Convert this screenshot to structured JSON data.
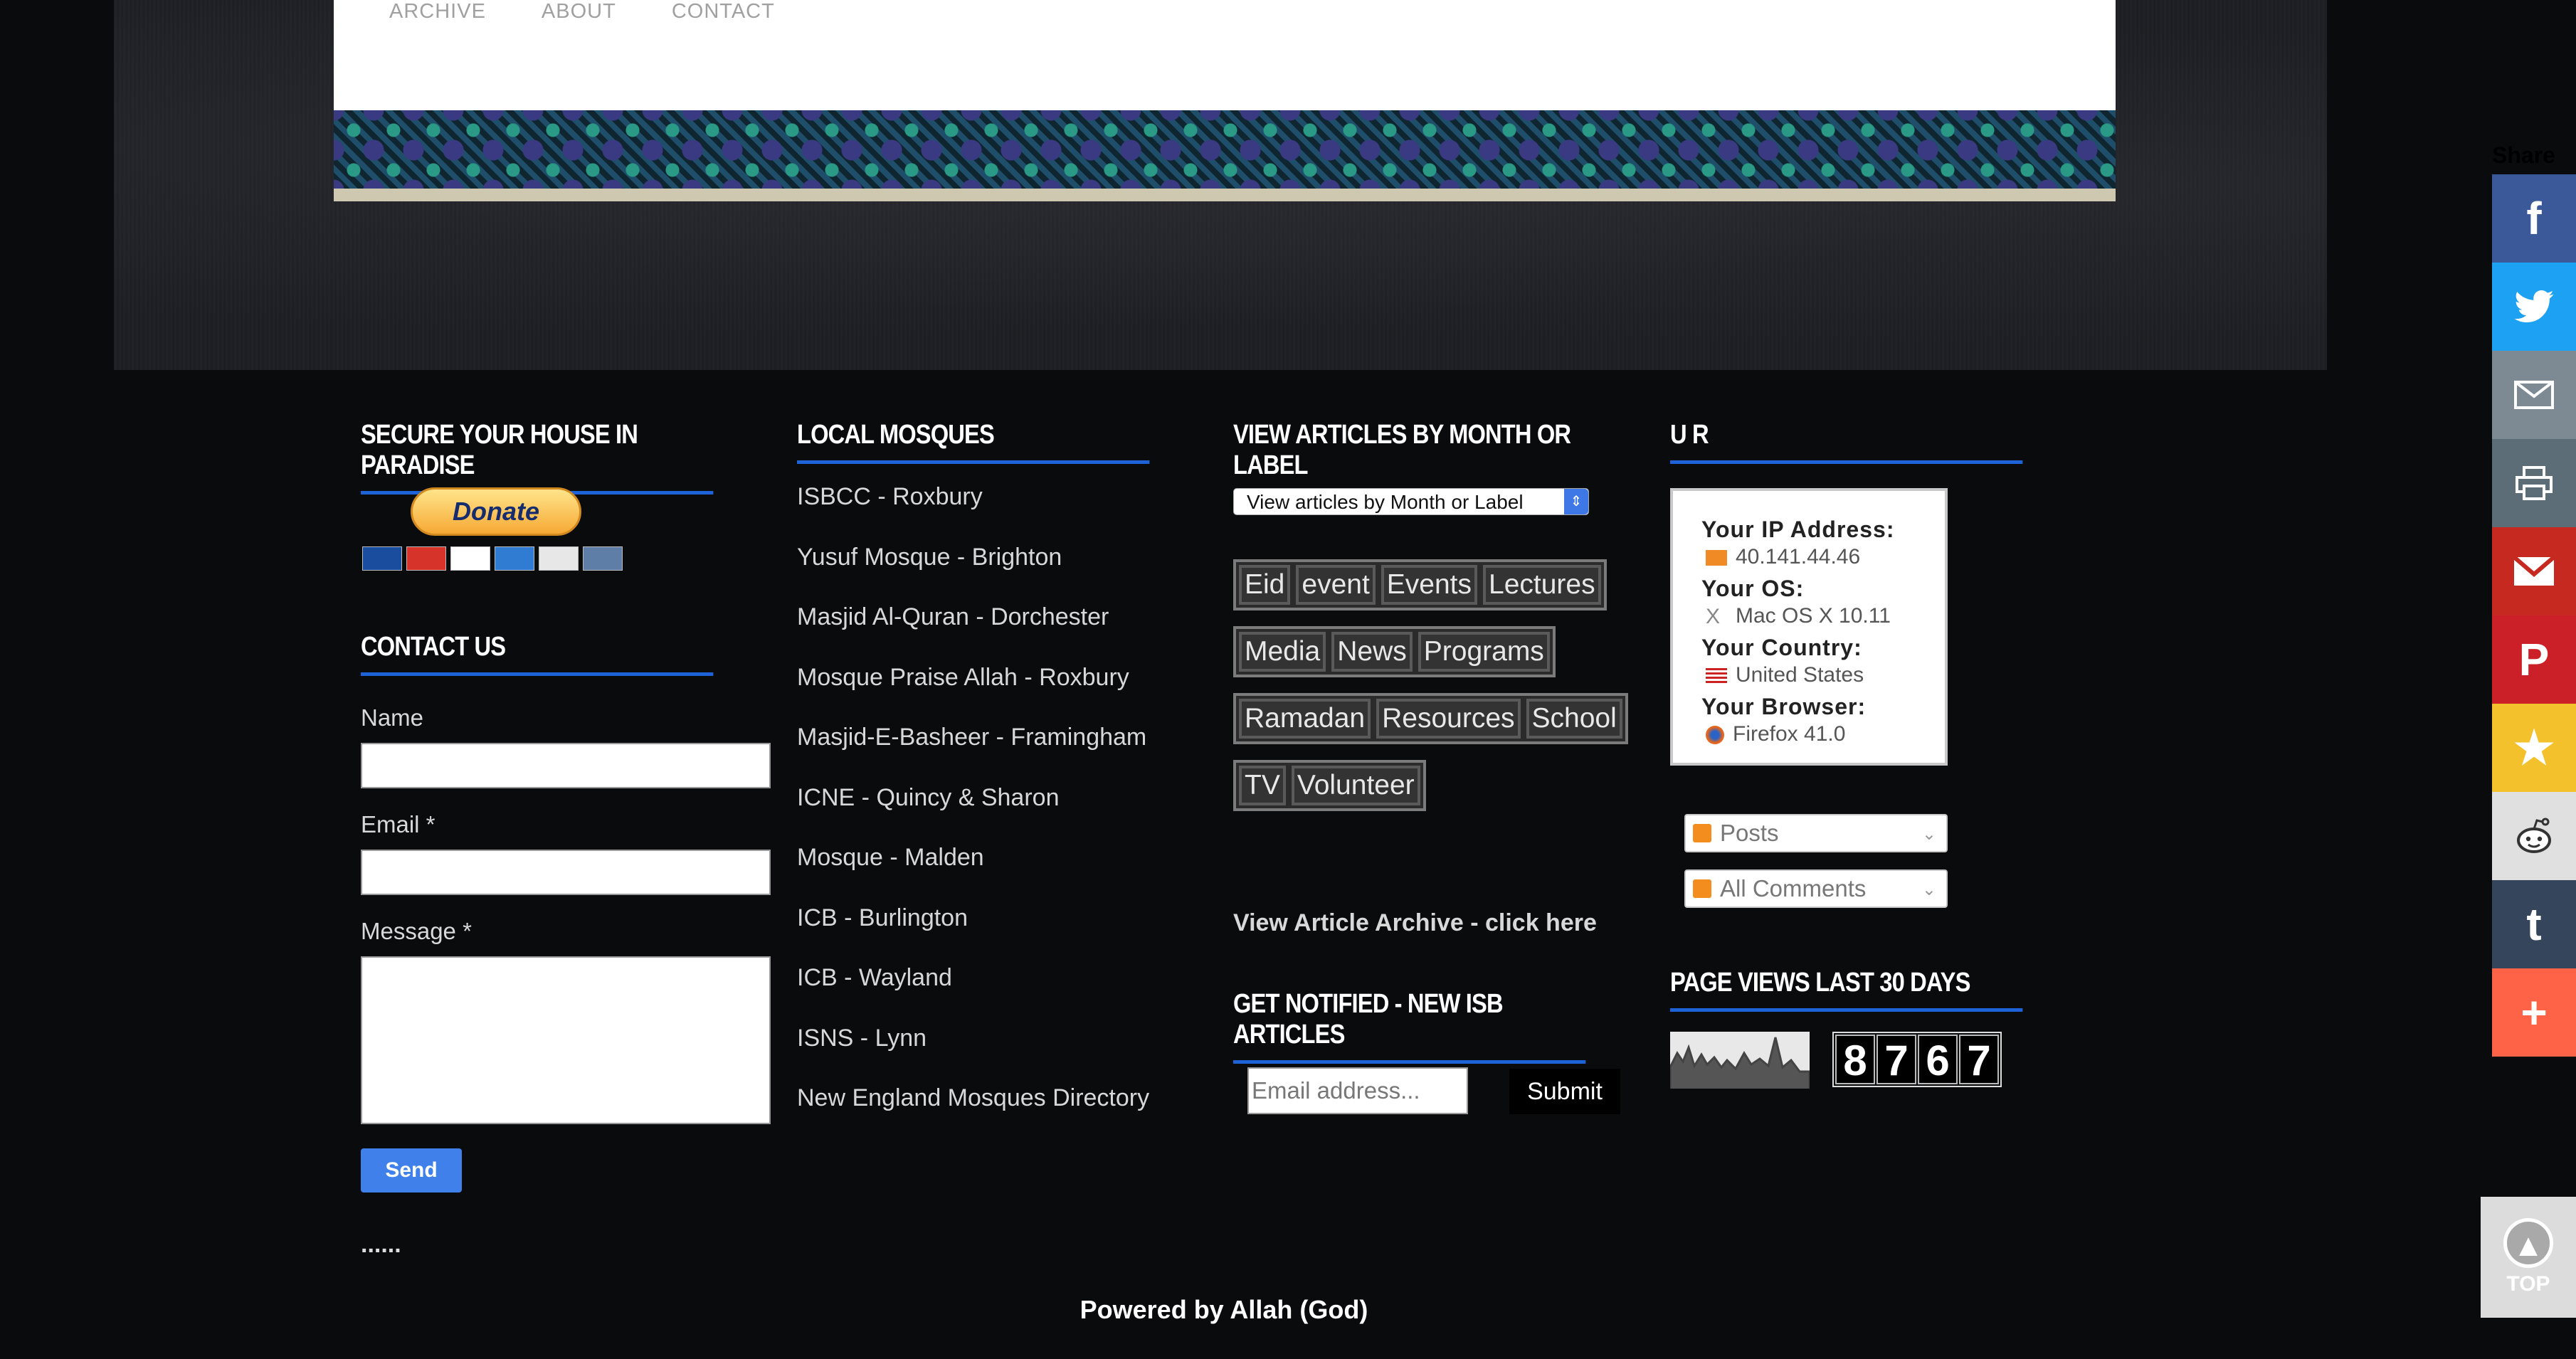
{
  "nav": [
    "ARCHIVE",
    "ABOUT",
    "CONTACT"
  ],
  "col1": {
    "title": "SECURE YOUR HOUSE IN PARADISE",
    "donate": "Donate",
    "cards": [
      "Maestro",
      "MasterCard",
      "VISA",
      "AMEX",
      "DISCOVER",
      "BANK"
    ]
  },
  "contact": {
    "title": "CONTACT US",
    "name_label": "Name",
    "email_label": "Email *",
    "message_label": "Message *",
    "send": "Send",
    "dots": "......"
  },
  "col2": {
    "title": "LOCAL MOSQUES",
    "mosques": [
      "ISBCC - Roxbury",
      "Yusuf Mosque - Brighton",
      "Masjid Al-Quran - Dorchester",
      "Mosque Praise Allah - Roxbury",
      "Masjid-E-Basheer - Framingham",
      "ICNE - Quincy & Sharon",
      "Mosque - Malden",
      "ICB - Burlington",
      "ICB - Wayland",
      "ISNS - Lynn",
      "New England Mosques Directory"
    ]
  },
  "col3": {
    "title": "VIEW ARTICLES BY MONTH OR LABEL",
    "select": "View articles by Month or Label",
    "label_rows": [
      [
        "Eid",
        "event",
        "Events",
        "Lectures"
      ],
      [
        "Media",
        "News",
        "Programs"
      ],
      [
        "Ramadan",
        "Resources",
        "School"
      ],
      [
        "TV",
        "Volunteer"
      ]
    ],
    "archive_link": "View Article Archive - click here",
    "notify_title": "GET NOTIFIED - NEW ISB ARTICLES",
    "email_placeholder": "Email address...",
    "submit": "Submit"
  },
  "col4": {
    "title": "U R",
    "ip_label": "Your IP Address:",
    "ip_value": "40.141.44.46",
    "os_label": "Your OS:",
    "os_value": "Mac OS X 10.11",
    "country_label": "Your Country:",
    "country_value": "United States",
    "browser_label": "Your Browser:",
    "browser_value": "Firefox 41.0",
    "feed_posts": "Posts",
    "feed_comments": "All Comments",
    "views_title": "PAGE VIEWS LAST 30 DAYS",
    "counter": [
      "8",
      "7",
      "6",
      "7"
    ]
  },
  "powered": "Powered by Allah (God)",
  "share": {
    "label": "Share",
    "colors": [
      "#3b5998",
      "#1da1f2",
      "#7d8a94",
      "#5d6d78",
      "#c5291f",
      "#cb2027",
      "#f3c12b",
      "#e0e0e0",
      "#35465c",
      "#ff6347"
    ],
    "icons": [
      "facebook-icon",
      "twitter-icon",
      "email-icon",
      "print-icon",
      "gmail-icon",
      "pinterest-icon",
      "favorite-icon",
      "reddit-icon",
      "tumblr-icon",
      "more-icon"
    ]
  },
  "top_button": "TOP"
}
